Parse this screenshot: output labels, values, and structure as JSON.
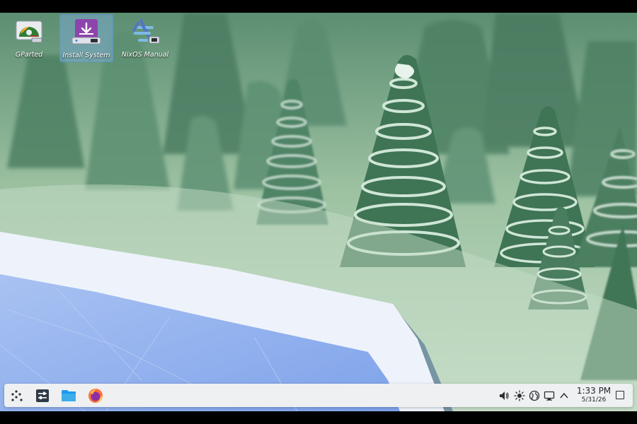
{
  "desktop": {
    "icons": [
      {
        "label": "GParted",
        "icon": "gparted-icon",
        "selected": false
      },
      {
        "label": "Install System",
        "icon": "install-system-icon",
        "selected": true
      },
      {
        "label": "NixOS Manual",
        "icon": "nixos-snowflake-icon",
        "selected": false
      }
    ]
  },
  "taskbar": {
    "launchers": [
      {
        "name": "application-launcher",
        "icon": "app-launcher-icon"
      },
      {
        "name": "system-settings",
        "icon": "settings-icon"
      },
      {
        "name": "file-manager",
        "icon": "folder-icon"
      },
      {
        "name": "firefox",
        "icon": "firefox-icon"
      }
    ],
    "tray": [
      {
        "name": "volume",
        "icon": "speaker-icon"
      },
      {
        "name": "brightness",
        "icon": "brightness-icon"
      },
      {
        "name": "network",
        "icon": "globe-icon"
      },
      {
        "name": "display",
        "icon": "display-icon"
      },
      {
        "name": "expand-tray",
        "icon": "chevron-up-icon"
      }
    ],
    "clock": {
      "time": "1:33 PM",
      "date": "5/31/26"
    },
    "show_desktop": "show-desktop-icon"
  },
  "colors": {
    "wallpaper_base": "#a9c9ac",
    "tree_dark": "#3e6e52",
    "tree_light": "#d9ece0",
    "river": "#8fb0ee",
    "panel": "#eef0f2",
    "accent_purple": "#8e44ad"
  }
}
